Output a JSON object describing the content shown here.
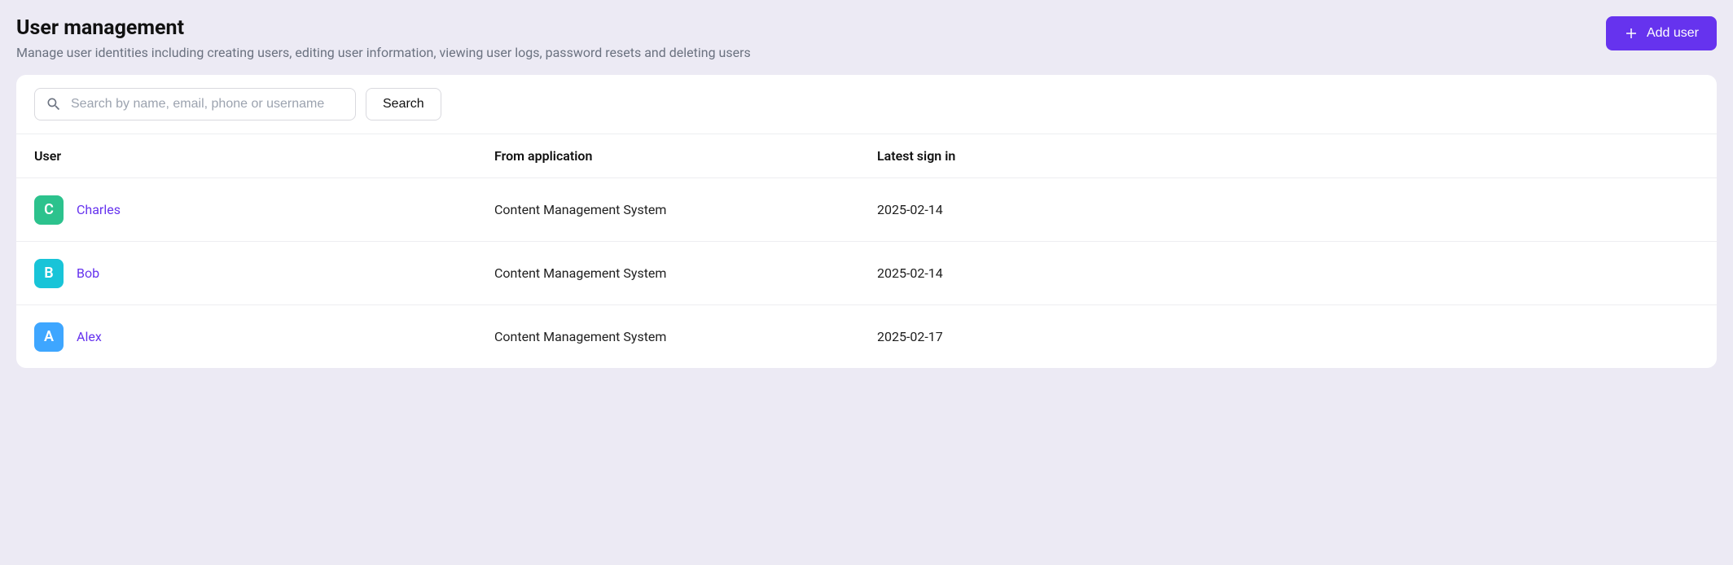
{
  "header": {
    "title": "User management",
    "subtitle": "Manage user identities including creating users, editing user information, viewing user logs, password resets and deleting users",
    "add_user_label": "Add user"
  },
  "search": {
    "placeholder": "Search by name, email, phone or username",
    "value": "",
    "button_label": "Search"
  },
  "table": {
    "columns": {
      "user": "User",
      "app": "From application",
      "date": "Latest sign in"
    },
    "rows": [
      {
        "initial": "C",
        "name": "Charles",
        "avatar_color": "#2CC28D",
        "application": "Content Management System",
        "last_sign_in": "2025-02-14"
      },
      {
        "initial": "B",
        "name": "Bob",
        "avatar_color": "#18C4D8",
        "application": "Content Management System",
        "last_sign_in": "2025-02-14"
      },
      {
        "initial": "A",
        "name": "Alex",
        "avatar_color": "#3EA6FF",
        "application": "Content Management System",
        "last_sign_in": "2025-02-17"
      }
    ]
  }
}
